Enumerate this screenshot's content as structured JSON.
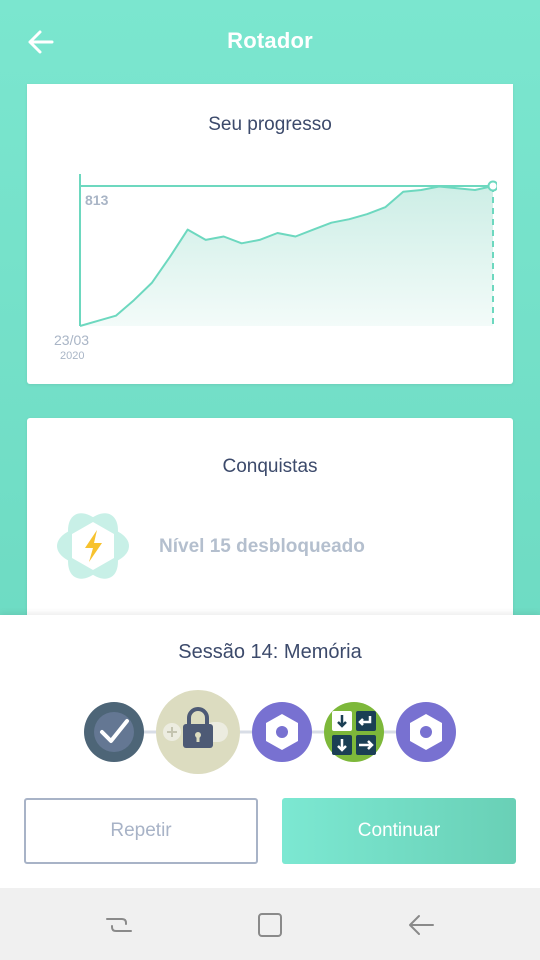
{
  "header": {
    "title": "Rotador",
    "back_icon": "arrow-left-icon"
  },
  "progress_card": {
    "title": "Seu progresso"
  },
  "chart_data": {
    "type": "area",
    "title": "Seu progresso",
    "start_label": "23/03",
    "start_year": "2020",
    "max_label": "813",
    "values": [
      0,
      30,
      60,
      150,
      250,
      400,
      560,
      500,
      520,
      480,
      500,
      540,
      520,
      560,
      600,
      620,
      650,
      690,
      780,
      790,
      810,
      800,
      790,
      813
    ],
    "colors": {
      "line": "#6dd8bf",
      "fill_top": "#cdeee6",
      "fill_bottom": "#f3fbf9",
      "axis": "#6dd8bf"
    }
  },
  "achievements_card": {
    "title": "Conquistas",
    "item_text": "Nível 15 desbloqueado",
    "item_icon": "lightning-badge-icon"
  },
  "session": {
    "title": "Sessão 14: Memória",
    "nodes": [
      {
        "name": "completed",
        "icon": "check-icon",
        "color": "#4d6577"
      },
      {
        "name": "current-locked",
        "icon": "lock-icon",
        "color": "#dcdcc0"
      },
      {
        "name": "hexagon",
        "icon": "hexagon-icon",
        "color": "#7871d1"
      },
      {
        "name": "arrows",
        "icon": "arrows-grid-icon",
        "color": "#7db83a"
      },
      {
        "name": "hexagon-2",
        "icon": "hexagon-icon",
        "color": "#7871d1"
      }
    ]
  },
  "buttons": {
    "repeat": "Repetir",
    "continue": "Continuar"
  },
  "system_nav": {
    "recent": "recent-apps-icon",
    "home": "home-icon",
    "back": "back-icon"
  }
}
